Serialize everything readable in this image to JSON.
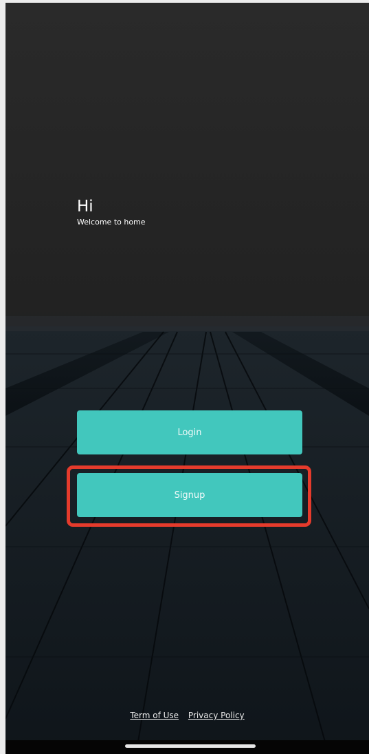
{
  "greeting": {
    "title": "Hi",
    "subtitle": "Welcome to home"
  },
  "buttons": {
    "login_label": "Login",
    "signup_label": "Signup"
  },
  "footer": {
    "terms_label": "Term of Use",
    "privacy_label": "Privacy Policy"
  },
  "colors": {
    "accent": "#42c7bd",
    "highlight": "#e53b2c",
    "background": "#222222"
  }
}
